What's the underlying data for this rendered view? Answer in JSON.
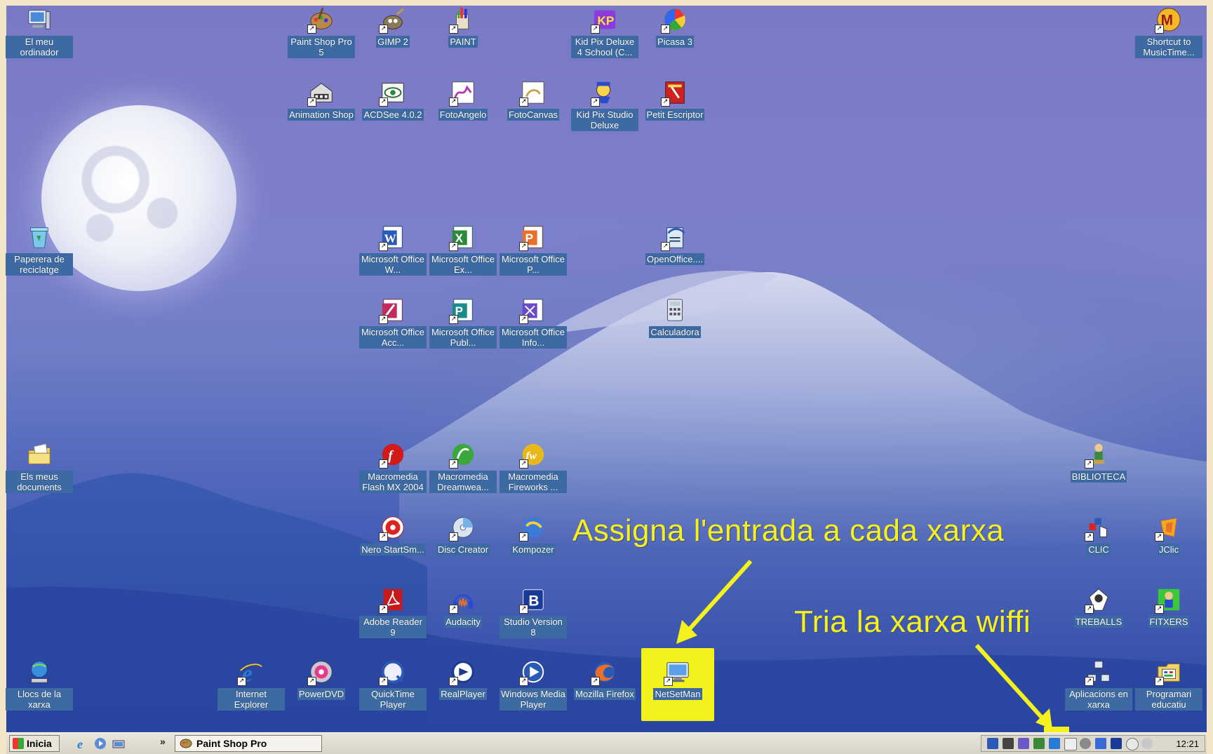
{
  "desktop_icons": {
    "el_meu_ordinador": "El meu ordinador",
    "paint_shop_pro_5": "Paint Shop Pro 5",
    "gimp2": "GIMP 2",
    "paint": "PAINT",
    "kid_pix_deluxe": "Kid Pix Deluxe 4 School (C...",
    "picasa3": "Picasa 3",
    "shortcut_musictime": "Shortcut to MusicTime...",
    "animation_shop": "Animation Shop",
    "acdsee": "ACDSee 4.0.2",
    "fotoangelo": "FotoAngelo",
    "fotocanvas": "FotoCanvas",
    "kid_pix_studio": "Kid Pix Studio Deluxe",
    "petit_escriptor": "Petit Escriptor",
    "paperera": "Paperera de reciclatge",
    "office_word": "Microsoft Office W...",
    "office_excel": "Microsoft Office Ex...",
    "office_ppt": "Microsoft Office P...",
    "openoffice": "OpenOffice....",
    "office_access": "Microsoft Office Acc...",
    "office_publisher": "Microsoft Office Publ...",
    "office_infopath": "Microsoft Office Info...",
    "calculadora": "Calculadora",
    "els_meus_documents": "Els meus documents",
    "flash": "Macromedia Flash MX 2004",
    "dreamweaver": "Macromedia Dreamwea...",
    "fireworks": "Macromedia Fireworks ...",
    "biblioteca": "BIBLIOTECA",
    "nero": "Nero StartSm...",
    "disc_creator": "Disc Creator",
    "kompozer": "Kompozer",
    "clic": "CLIC",
    "jclic": "JClic",
    "adobe_reader": "Adobe Reader 9",
    "audacity": "Audacity",
    "studio_version": "Studio Version 8",
    "treballs": "TREBALLS",
    "fitxers": "FITXERS",
    "llocs_xarxa": "Llocs de la xarxa",
    "internet_explorer": "Internet Explorer",
    "powerdvd": "PowerDVD",
    "quicktime": "QuickTime Player",
    "realplayer": "RealPlayer",
    "wmp": "Windows Media Player",
    "firefox": "Mozilla Firefox",
    "netsetman": "NetSetMan",
    "aplicacions_xarxa": "Aplicacions en xarxa",
    "programari_educatiu": "Programari educatiu"
  },
  "annotations": {
    "assign": "Assigna l'entrada a  cada xarxa",
    "wifi": "Tria la xarxa wiffi"
  },
  "taskbar": {
    "start_label": "Inicia",
    "chevron": "»",
    "active_task": "Paint Shop Pro",
    "clock": "12:21"
  },
  "colors": {
    "highlight": "#f4f21c",
    "annotation_text": "#f7f01f",
    "icon_label_bg": "#3d6aa3"
  }
}
